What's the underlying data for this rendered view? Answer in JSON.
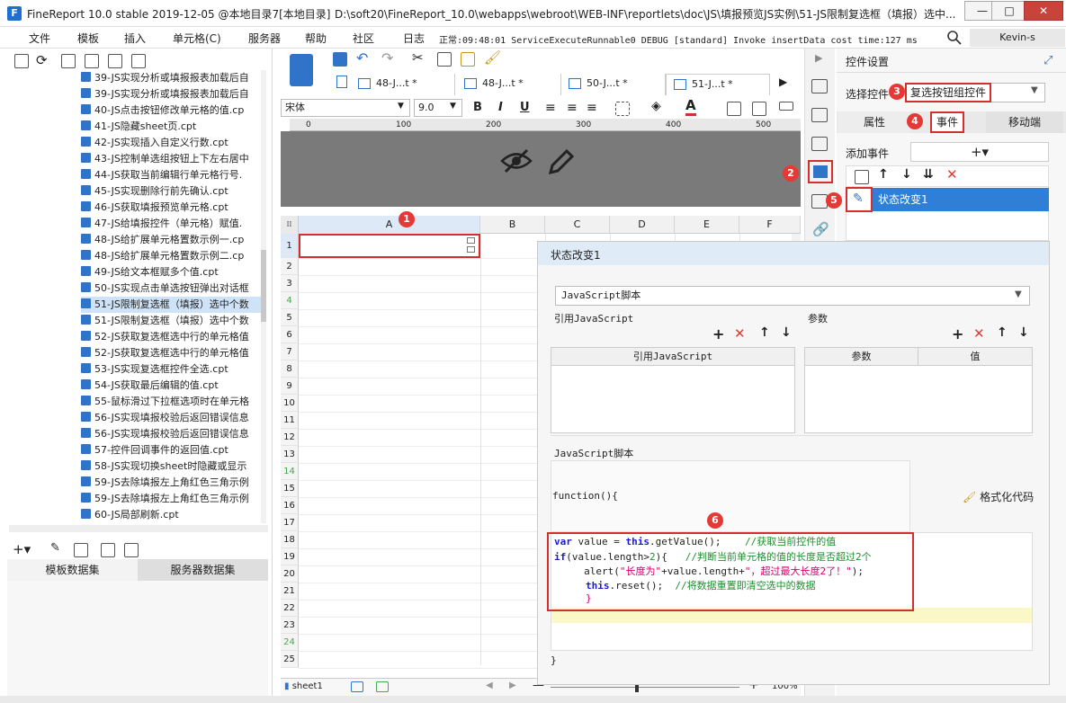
{
  "window": {
    "title": "FineReport 10.0 stable 2019-12-05 @本地目录7[本地目录]",
    "path": "D:\\soft20\\FineReport_10.0\\webapps\\webroot\\WEB-INF\\reportlets\\doc\\JS\\填报预览JS实例\\51-JS限制复选框（填报）选中...",
    "minimize": "—",
    "maximize": "□",
    "close": "✕"
  },
  "menu": {
    "items": [
      "文件",
      "模板",
      "插入",
      "单元格(C)",
      "服务器",
      "帮助",
      "社区"
    ],
    "log_label": "日志",
    "log_text": "正常:09:48:01 ServiceExecuteRunnable0 DEBUG [standard] Invoke insertData cost time:127 ms",
    "user": "Kevin-s"
  },
  "tree": {
    "items": [
      {
        "label": "39-JS实现分析或填报报表加载后自",
        "selected": false
      },
      {
        "label": "39-JS实现分析或填报报表加载后自",
        "selected": false
      },
      {
        "label": "40-JS点击按钮修改单元格的值.cp",
        "selected": false
      },
      {
        "label": "41-JS隐藏sheet页.cpt",
        "selected": false
      },
      {
        "label": "42-JS实现插入自定义行数.cpt",
        "selected": false
      },
      {
        "label": "43-JS控制单选组按钮上下左右居中",
        "selected": false
      },
      {
        "label": "44-JS获取当前编辑行单元格行号.",
        "selected": false
      },
      {
        "label": "45-JS实现删除行前先确认.cpt",
        "selected": false
      },
      {
        "label": "46-JS获取填报预览单元格.cpt",
        "selected": false
      },
      {
        "label": "47-JS给填报控件（单元格）赋值.",
        "selected": false
      },
      {
        "label": "48-JS给扩展单元格置数示例一.cp",
        "selected": false
      },
      {
        "label": "48-JS给扩展单元格置数示例二.cp",
        "selected": false
      },
      {
        "label": "49-JS给文本框赋多个值.cpt",
        "selected": false
      },
      {
        "label": "50-JS实现点击单选按钮弹出对话框",
        "selected": false
      },
      {
        "label": "51-JS限制复选框（填报）选中个数",
        "selected": true
      },
      {
        "label": "51-JS限制复选框（填报）选中个数",
        "selected": false
      },
      {
        "label": "52-JS获取复选框选中行的单元格值",
        "selected": false
      },
      {
        "label": "52-JS获取复选框选中行的单元格值",
        "selected": false
      },
      {
        "label": "53-JS实现复选框控件全选.cpt",
        "selected": false
      },
      {
        "label": "54-JS获取最后编辑的值.cpt",
        "selected": false
      },
      {
        "label": "55-鼠标滑过下拉框选项时在单元格",
        "selected": false
      },
      {
        "label": "56-JS实现填报校验后返回错误信息",
        "selected": false
      },
      {
        "label": "56-JS实现填报校验后返回错误信息",
        "selected": false
      },
      {
        "label": "57-控件回调事件的返回值.cpt",
        "selected": false
      },
      {
        "label": "58-JS实现切换sheet时隐藏或显示",
        "selected": false
      },
      {
        "label": "59-JS去除填报左上角红色三角示例",
        "selected": false
      },
      {
        "label": "59-JS去除填报左上角红色三角示例",
        "selected": false
      },
      {
        "label": "60-JS局部刷新.cpt",
        "selected": false
      }
    ]
  },
  "datasets": {
    "template": "模板数据集",
    "server": "服务器数据集"
  },
  "tabs": [
    {
      "label": "48-J...t *",
      "active": false
    },
    {
      "label": "48-J...t *",
      "active": false
    },
    {
      "label": "50-J...t *",
      "active": false
    },
    {
      "label": "51-J...t *",
      "active": true
    }
  ],
  "format": {
    "font": "宋体",
    "size": "9.0",
    "bold": "B",
    "italic": "I",
    "underline": "U"
  },
  "ruler": {
    "ticks": [
      "0",
      "100",
      "200",
      "300",
      "400",
      "500"
    ]
  },
  "grid": {
    "columns": [
      "A",
      "B",
      "C",
      "D",
      "E",
      "F"
    ],
    "rows": [
      "1",
      "2",
      "3",
      "4",
      "5",
      "6",
      "7",
      "8",
      "9",
      "10",
      "11",
      "12",
      "13",
      "14",
      "15",
      "16",
      "17",
      "18",
      "19",
      "20",
      "21",
      "22",
      "23",
      "24",
      "25"
    ],
    "green_rows": [
      "4",
      "14",
      "24"
    ],
    "sheet": "sheet1",
    "zoom": "100%"
  },
  "right_panel": {
    "title": "控件设置",
    "select_label": "选择控件",
    "select_value": "复选按钮组控件",
    "tabs": [
      "属性",
      "事件",
      "移动端"
    ],
    "add_event_label": "添加事件",
    "add_event_symbol": "+▾",
    "event_item": "状态改变1"
  },
  "badges": [
    "1",
    "2",
    "3",
    "4",
    "5",
    "6"
  ],
  "dialog": {
    "title": "状态改变1",
    "language": "JavaScript脚本",
    "ref_js_label": "引用JavaScript",
    "param_label": "参数",
    "ref_js_col": "引用JavaScript",
    "param_col": "参数",
    "value_col": "值",
    "script_label": "JavaScript脚本",
    "function_open": "function(){",
    "function_close": "}",
    "format_button": "格式化代码",
    "code": {
      "l1_kw": "var",
      "l1_a": " value = ",
      "l1_this": "this",
      "l1_b": ".getValue();    ",
      "l1_cm": "//获取当前控件的值",
      "l2_kw": "if",
      "l2_a": "(value.length>",
      "l2_num": "2",
      "l2_b": "){   ",
      "l2_cm": "//判断当前单元格的值的长度是否超过2个",
      "l3_a": "     alert(",
      "l3_str1": "\"长度为\"",
      "l3_b": "+value.length+",
      "l3_str2": "\"，超过最大长度2了！\"",
      "l3_c": ");",
      "l4_this": "this",
      "l4_a": ".reset();  ",
      "l4_cm": "//将数据重置即清空选中的数据",
      "l5": "}"
    }
  }
}
